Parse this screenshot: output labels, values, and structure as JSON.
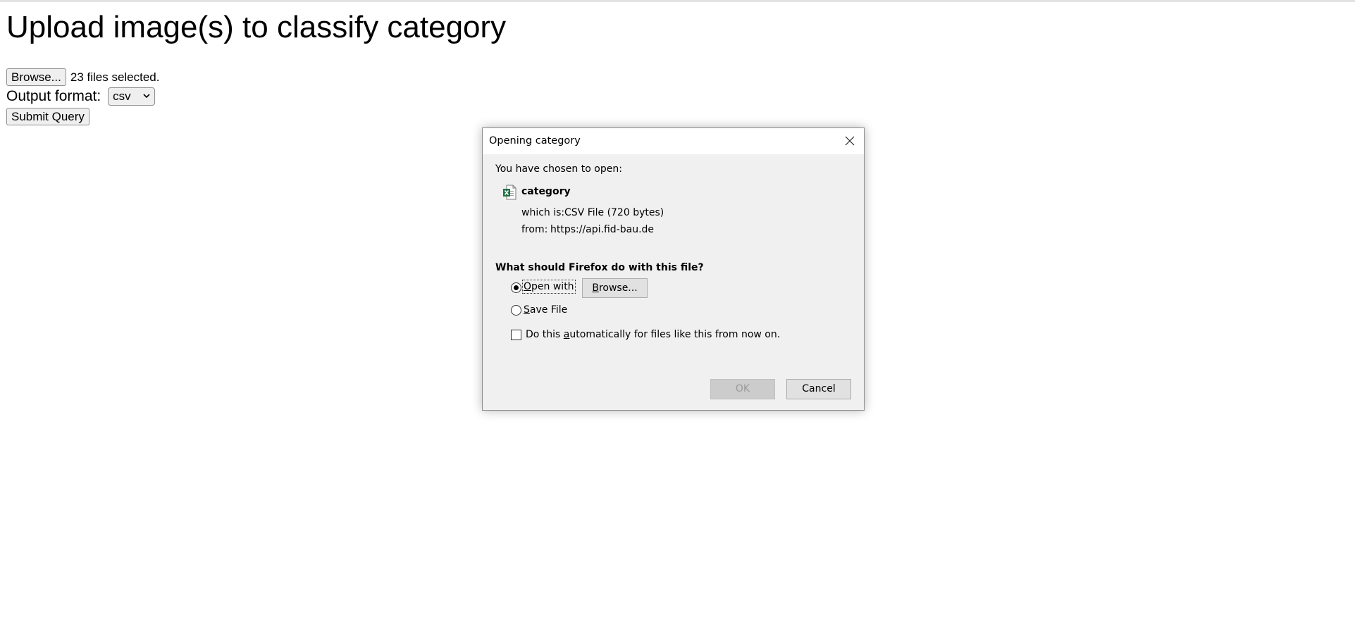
{
  "page": {
    "heading": "Upload image(s) to classify category",
    "browse_label": "Browse...",
    "files_selected": "23 files selected.",
    "output_format_label": "Output format:",
    "output_format_value": "csv",
    "submit_label": "Submit Query"
  },
  "dialog": {
    "title": "Opening category",
    "intro": "You have chosen to open:",
    "file_name": "category",
    "which_is_label": "which is:",
    "which_is_value": "CSV File (720 bytes)",
    "from_label": "from:",
    "from_value": "https://api.fid-bau.de",
    "question": "What should Firefox do with this file?",
    "open_with_label": "Open with",
    "browse_label": "Browse...",
    "save_file_label": "Save File",
    "auto_label": "Do this automatically for files like this from now on.",
    "ok_label": "OK",
    "cancel_label": "Cancel",
    "open_with_checked": true,
    "save_file_checked": false,
    "auto_checked": false
  },
  "icons": {
    "file_icon": "excel-csv-icon",
    "close": "close-icon",
    "chevron": "chevron-down-icon"
  },
  "colors": {
    "excel_green": "#1f7244",
    "dialog_bg": "#f0f0f0",
    "button_bg": "#e1e1e1"
  }
}
